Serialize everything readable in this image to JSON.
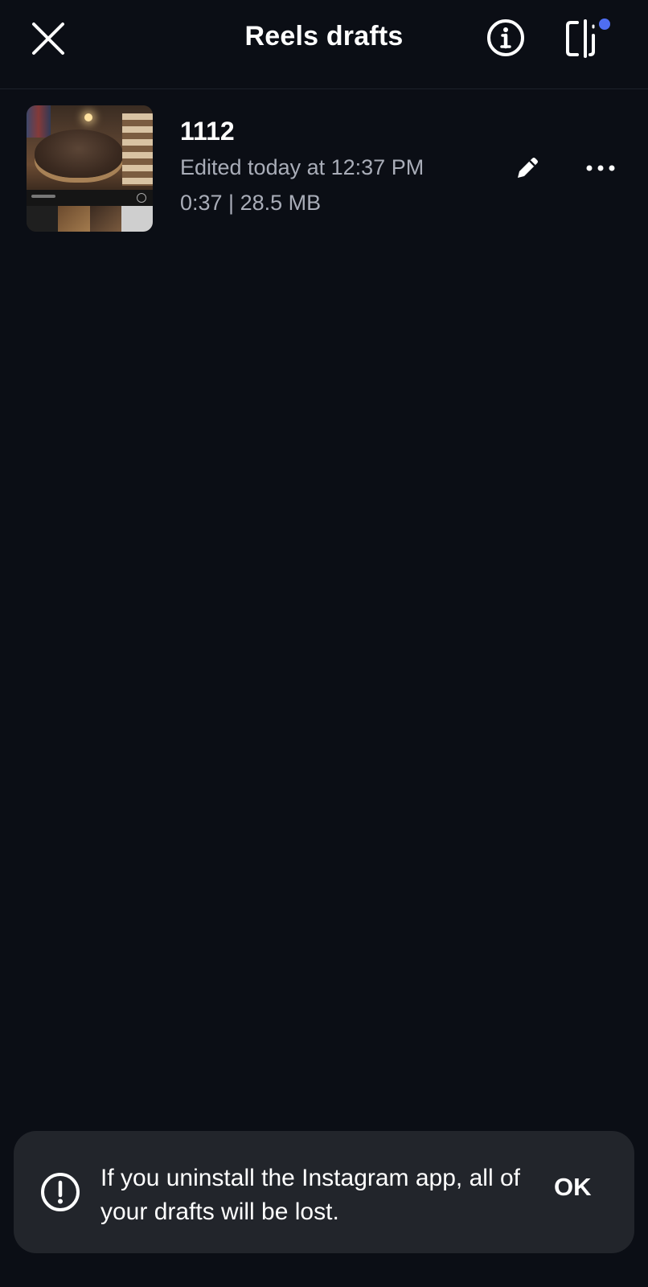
{
  "header": {
    "title": "Reels drafts",
    "close_icon": "close-icon",
    "info_icon": "info-icon",
    "layout_icon": "layout-toggle-icon",
    "notification_dot_color": "#4f6ef2"
  },
  "drafts": [
    {
      "title": "1112",
      "edited": "Edited today at 12:37 PM",
      "meta": "0:37 | 28.5 MB",
      "edit_icon": "pencil-icon",
      "more_icon": "more-horizontal-icon"
    }
  ],
  "toast": {
    "message": "If you uninstall the Instagram app, all of your drafts will be lost.",
    "ok_label": "OK",
    "icon": "alert-circle-icon",
    "background": "#22252b"
  },
  "colors": {
    "background": "#0b0e15",
    "primary_text": "#ffffff",
    "secondary_text": "#a9adb8"
  }
}
